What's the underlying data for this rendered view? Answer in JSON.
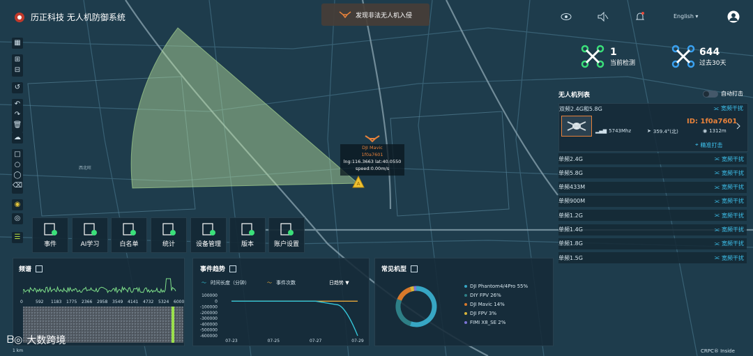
{
  "app": {
    "title": "历正科技 无人机防御系统",
    "language": "English ▾"
  },
  "alert": {
    "label": "发现非法无人机入侵"
  },
  "stats": [
    {
      "value": "1",
      "label": "当前检测"
    },
    {
      "value": "644",
      "label": "过去30天"
    }
  ],
  "uav_list": {
    "title": "无人机列表",
    "auto_strike_label": "自动打击",
    "band_header": "双频2.4G和5.8G",
    "jam_label": "宽频干扰",
    "detected": {
      "id": "ID: 1f0a7601",
      "freq": "5743Mhz",
      "bearing": "359.4°(北)",
      "distance": "1312m",
      "precise_strike": "精准打击"
    },
    "bands": [
      "单频2.4G",
      "单频5.8G",
      "单频433M",
      "单频900M",
      "单频1.2G",
      "单频1.4G",
      "单频1.8G",
      "单频1.5G"
    ]
  },
  "map_target": {
    "name": "DJI Mavic",
    "id": "1f0a7601",
    "coords": "lng:116.3663 lat:40.0550",
    "speed": "speed:0.00m/s"
  },
  "quick_buttons": [
    {
      "label": "事件",
      "icon": "event-icon"
    },
    {
      "label": "AI学习",
      "icon": "ai-learning-icon"
    },
    {
      "label": "白名单",
      "icon": "whitelist-icon"
    },
    {
      "label": "统计",
      "icon": "statistics-icon"
    },
    {
      "label": "设备管理",
      "icon": "device-management-icon"
    },
    {
      "label": "版本",
      "icon": "version-icon"
    },
    {
      "label": "账户设置",
      "icon": "account-settings-icon"
    }
  ],
  "spectrum": {
    "title": "频谱",
    "x_ticks": [
      "0",
      "592",
      "1183",
      "1775",
      "2366",
      "2958",
      "3549",
      "4141",
      "4732",
      "5324",
      "6000"
    ]
  },
  "trend": {
    "title": "事件趋势",
    "legend": [
      "时间长度（分钟）",
      "事件次数"
    ],
    "range_label": "日趋势 ▼",
    "colors": {
      "duration": "#35c6d8",
      "count": "#e8a93a"
    },
    "chart_data": {
      "type": "line",
      "x_ticks": [
        "07-23",
        "07-25",
        "07-27",
        "07-29"
      ],
      "y_ticks": [
        "100000",
        "0",
        "-100000",
        "-200000",
        "-300000",
        "-400000",
        "-500000",
        "-600000"
      ],
      "ylim": [
        -600000,
        100000
      ],
      "series": [
        {
          "name": "时间长度（分钟）",
          "x": [
            "07-23",
            "07-24",
            "07-25",
            "07-26",
            "07-27",
            "07-28",
            "07-29"
          ],
          "values": [
            0,
            0,
            0,
            0,
            0,
            -60000,
            -600000
          ]
        },
        {
          "name": "事件次数",
          "x": [
            "07-23",
            "07-24",
            "07-25",
            "07-26",
            "07-27",
            "07-28",
            "07-29"
          ],
          "values": [
            0,
            0,
            0,
            0,
            0,
            0,
            0
          ]
        }
      ]
    }
  },
  "models": {
    "title": "常见机型",
    "chart_data": {
      "type": "pie",
      "labels": [
        "DJI Phantom4/4Pro 55%",
        "DIY FPV 26%",
        "DJI Mavic 14%",
        "DJI FPV 3%",
        "FIMI X8_SE 2%"
      ],
      "values": [
        55,
        26,
        14,
        3,
        2
      ],
      "colors": [
        "#37a6c4",
        "#2e7f86",
        "#d9792b",
        "#d9b53a",
        "#7b74d6"
      ]
    }
  },
  "map_labels": [
    "西北旺",
    "1 km",
    "CRPC® Inside",
    "大数跨境"
  ]
}
